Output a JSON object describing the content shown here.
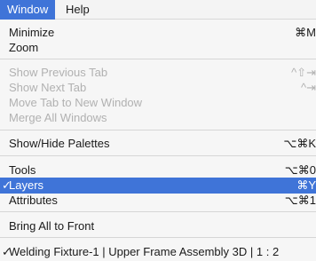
{
  "colors": {
    "accent": "#3f74d8",
    "disabled_text": "#b1b1b1"
  },
  "menubar": {
    "items": [
      {
        "label": "Window",
        "active": true
      },
      {
        "label": "Help",
        "active": false
      }
    ]
  },
  "menu": {
    "groups": [
      [
        {
          "label": "Minimize",
          "shortcut": "⌘M"
        },
        {
          "label": "Zoom",
          "shortcut": ""
        }
      ],
      [
        {
          "label": "Show Previous Tab",
          "shortcut": "^⇧⇥",
          "disabled": true
        },
        {
          "label": "Show Next Tab",
          "shortcut": "^⇥",
          "disabled": true
        },
        {
          "label": "Move Tab to New Window",
          "shortcut": "",
          "disabled": true
        },
        {
          "label": "Merge All Windows",
          "shortcut": "",
          "disabled": true
        }
      ],
      [
        {
          "label": "Show/Hide Palettes",
          "shortcut": "⌥⌘K"
        }
      ],
      [
        {
          "label": "Tools",
          "shortcut": "⌥⌘0"
        },
        {
          "label": "Layers",
          "shortcut": "⌘Y",
          "selected": true,
          "checked": true
        },
        {
          "label": "Attributes",
          "shortcut": "⌥⌘1"
        }
      ],
      [
        {
          "label": "Bring All to Front",
          "shortcut": ""
        }
      ],
      [
        {
          "label": "Welding Fixture-1 | Upper Frame Assembly 3D | 1 : 2",
          "shortcut": "",
          "checked": true
        }
      ]
    ],
    "check_glyph": "✓"
  }
}
